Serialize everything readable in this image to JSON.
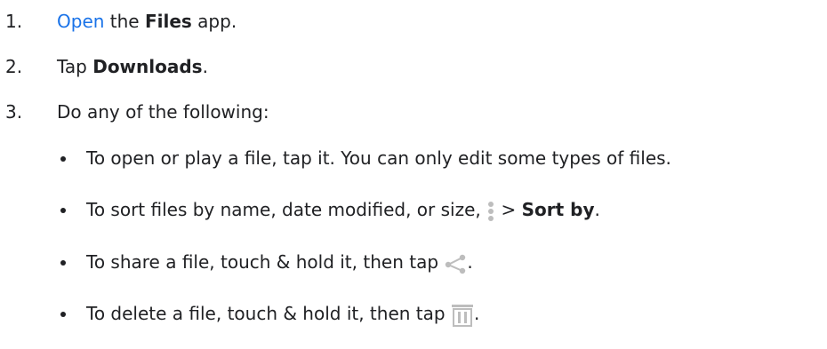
{
  "steps": [
    {
      "number": "1.",
      "link": "Open",
      "text_a": " the ",
      "bold": "Files",
      "text_b": " app."
    },
    {
      "number": "2.",
      "text_a": "Tap ",
      "bold": "Downloads",
      "text_b": "."
    },
    {
      "number": "3.",
      "text": "Do any of the following:"
    }
  ],
  "bullets": [
    {
      "text": "To open or play a file, tap it. You can only edit some types of files."
    },
    {
      "text_a": "To sort files by name, date modified, or size, ",
      "icon": "more-vert-icon",
      "text_b": " > ",
      "bold": "Sort by",
      "text_c": "."
    },
    {
      "text_a": "To share a file, touch & hold it, then tap ",
      "icon": "share-icon",
      "text_b": "."
    },
    {
      "text_a": "To delete a file, touch & hold it, then tap ",
      "icon": "trash-icon",
      "text_b": "."
    }
  ],
  "colors": {
    "text": "#202124",
    "link": "#1a73e8",
    "icon": "#bdbdbd"
  }
}
